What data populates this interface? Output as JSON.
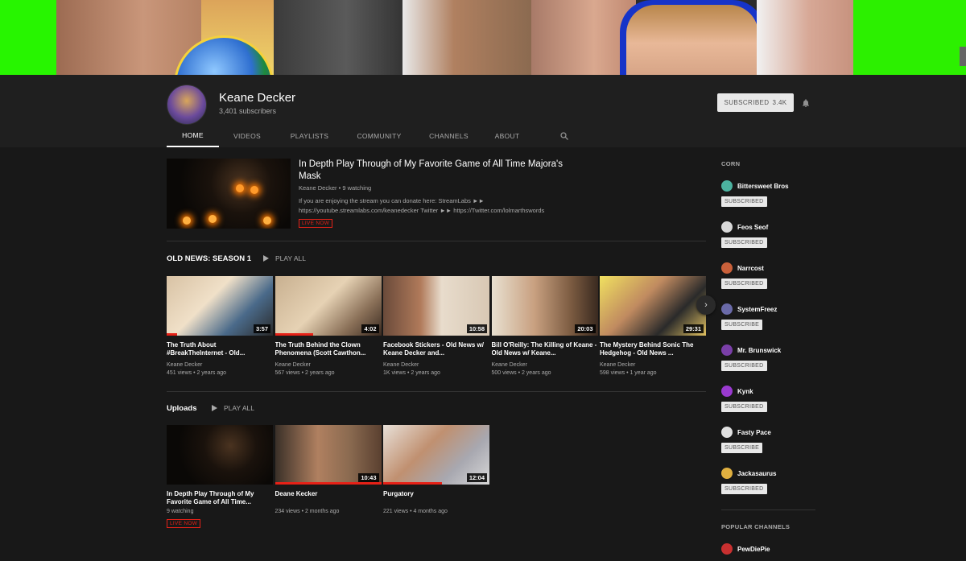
{
  "channel": {
    "name": "Keane Decker",
    "subscribers": "3,401 subscribers",
    "subscribe_label": "SUBSCRIBED",
    "subscribe_count": "3.4K"
  },
  "tabs": [
    "HOME",
    "VIDEOS",
    "PLAYLISTS",
    "COMMUNITY",
    "CHANNELS",
    "ABOUT"
  ],
  "featured": {
    "title": "In Depth Play Through of My Favorite Game of All Time Majora's Mask",
    "channel": "Keane Decker",
    "watching": "9 watching",
    "description": "If you are enjoying the stream you can donate here: StreamLabs ►► https://youtube.streamlabs.com/keanedecker Twitter ►► https://Twitter.com/lolmarthswords",
    "live_label": "LIVE NOW"
  },
  "section1": {
    "title": "OLD NEWS: SEASON 1",
    "play_all": "PLAY ALL",
    "videos": [
      {
        "title": "The Truth About #BreakTheInternet - Old...",
        "channel": "Keane Decker",
        "stats": "451 views • 2 years ago",
        "duration": "3:57",
        "progress": 0.1
      },
      {
        "title": "The Truth Behind the Clown Phenomena (Scott Cawthon...",
        "channel": "Keane Decker",
        "stats": "567 views • 2 years ago",
        "duration": "4:02",
        "progress": 0.36
      },
      {
        "title": "Facebook Stickers - Old News w/ Keane Decker and...",
        "channel": "Keane Decker",
        "stats": "1K views • 2 years ago",
        "duration": "10:58",
        "progress": 0
      },
      {
        "title": "Bill O'Reilly: The Killing of Keane - Old News w/ Keane...",
        "channel": "Keane Decker",
        "stats": "500 views • 2 years ago",
        "duration": "20:03",
        "progress": 0
      },
      {
        "title": "The Mystery Behind Sonic The Hedgehog - Old News ...",
        "channel": "Keane Decker",
        "stats": "598 views • 1 year ago",
        "duration": "29:31",
        "progress": 0
      }
    ]
  },
  "section2": {
    "title": "Uploads",
    "play_all": "PLAY ALL",
    "videos": [
      {
        "title": "In Depth Play Through of My Favorite Game of All Time...",
        "channel": "",
        "stats": "9 watching",
        "duration": "",
        "live": "LIVE NOW"
      },
      {
        "title": "Deane Kecker",
        "channel": "",
        "stats": "234 views • 2 months ago",
        "duration": "10:43",
        "progress": 1
      },
      {
        "title": "Purgatory",
        "channel": "",
        "stats": "221 views • 4 months ago",
        "duration": "12:04",
        "progress": 0.55
      }
    ]
  },
  "sidebar": {
    "heading1": "CORN",
    "channels": [
      {
        "name": "Bittersweet Bros",
        "button": "SUBSCRIBED",
        "color": "#4cb3a0"
      },
      {
        "name": "Feos Seof",
        "button": "SUBSCRIBED",
        "color": "#d8d8d8"
      },
      {
        "name": "Narrcost",
        "button": "SUBSCRIBED",
        "color": "#c9603a"
      },
      {
        "name": "SystemFreez",
        "button": "SUBSCRIBE",
        "color": "#6a6aa8"
      },
      {
        "name": "Mr. Brunswick",
        "button": "SUBSCRIBED",
        "color": "#7a3fa8"
      },
      {
        "name": "Kynk",
        "button": "SUBSCRIBED",
        "color": "#9a3ad0"
      },
      {
        "name": "Fasty Pace",
        "button": "SUBSCRIBE",
        "color": "#e0e0e0"
      },
      {
        "name": "Jackasaurus",
        "button": "SUBSCRIBED",
        "color": "#e0b040"
      }
    ],
    "heading2": "POPULAR CHANNELS",
    "popular": [
      {
        "name": "PewDiePie",
        "color": "#c83030"
      }
    ]
  }
}
